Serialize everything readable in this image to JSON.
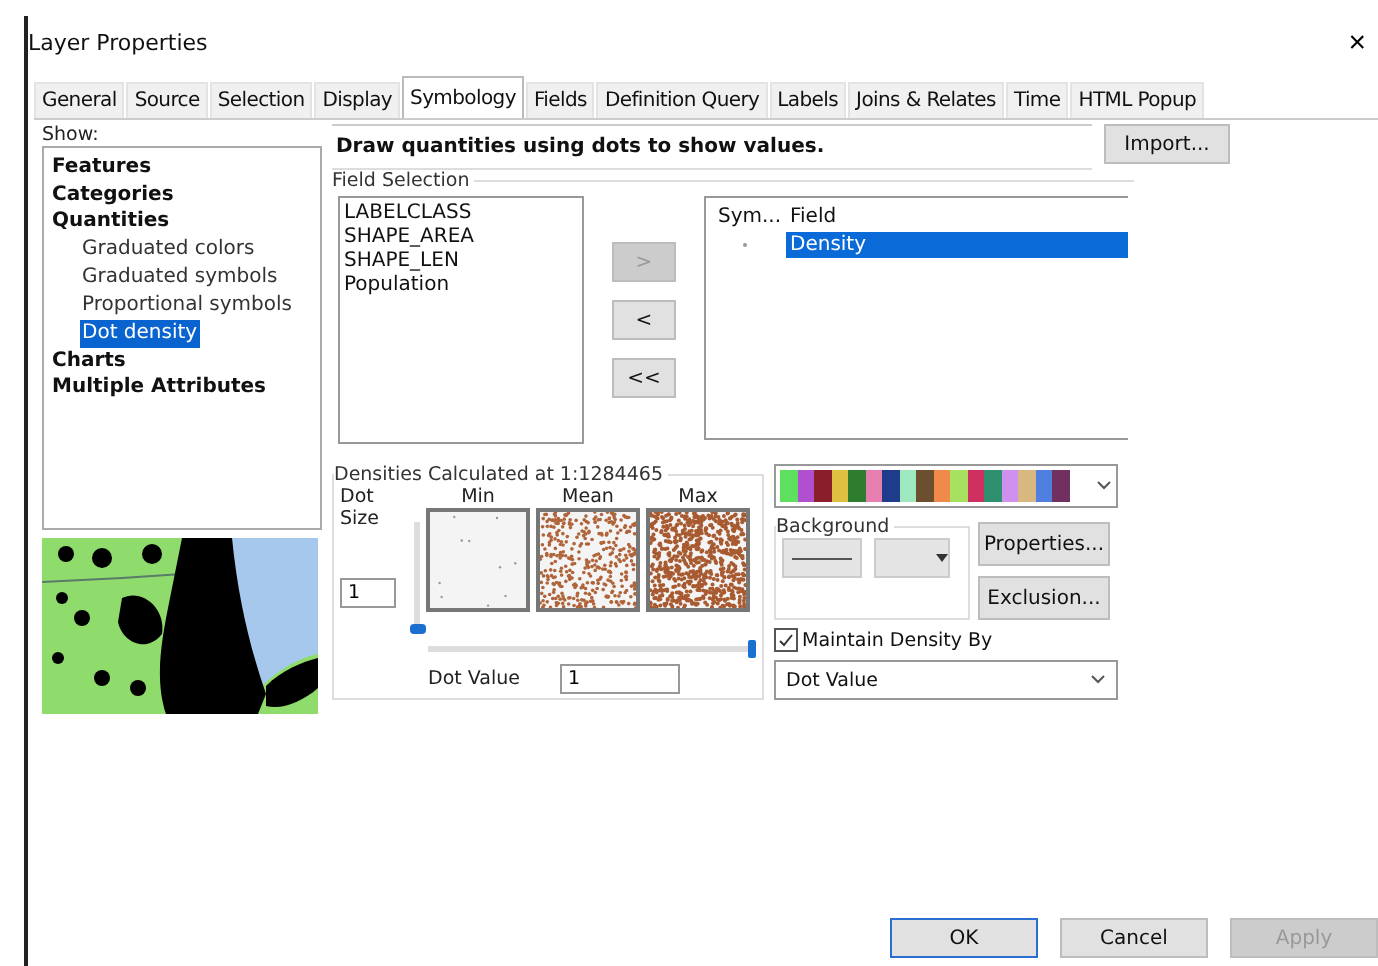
{
  "window": {
    "title": "Layer Properties",
    "close": "×"
  },
  "tabs": [
    {
      "label": "General",
      "selected": false
    },
    {
      "label": "Source",
      "selected": false
    },
    {
      "label": "Selection",
      "selected": false
    },
    {
      "label": "Display",
      "selected": false
    },
    {
      "label": "Symbology",
      "selected": true
    },
    {
      "label": "Fields",
      "selected": false
    },
    {
      "label": "Definition Query",
      "selected": false
    },
    {
      "label": "Labels",
      "selected": false
    },
    {
      "label": "Joins & Relates",
      "selected": false
    },
    {
      "label": "Time",
      "selected": false
    },
    {
      "label": "HTML Popup",
      "selected": false
    }
  ],
  "show_label": "Show:",
  "tree": [
    {
      "label": "Features",
      "selected": false
    },
    {
      "label": "Categories",
      "selected": false
    },
    {
      "label": "Quantities",
      "selected": false,
      "children": [
        {
          "label": "Graduated colors",
          "selected": false
        },
        {
          "label": "Graduated symbols",
          "selected": false
        },
        {
          "label": "Proportional symbols",
          "selected": false
        },
        {
          "label": "Dot density",
          "selected": true
        }
      ]
    },
    {
      "label": "Charts",
      "selected": false
    },
    {
      "label": "Multiple Attributes",
      "selected": false
    }
  ],
  "description": "Draw quantities using dots to show values.",
  "import_button": "Import...",
  "field_selection": {
    "title": "Field Selection",
    "fields": [
      "LABELCLASS",
      "SHAPE_AREA",
      "SHAPE_LEN",
      "Population"
    ],
    "buttons": [
      {
        "label": ">",
        "disabled": true
      },
      {
        "label": "<",
        "disabled": false
      },
      {
        "label": "<<",
        "disabled": false
      }
    ]
  },
  "symbol_table": {
    "columns": [
      "Sym...",
      "Field"
    ],
    "rows": [
      {
        "field": "Density",
        "selected": true
      }
    ]
  },
  "densities": {
    "title": "Densities Calculated at 1:1284465",
    "dot_size_label": "Dot Size",
    "dot_size": "1",
    "dot_size_slider": {
      "level": 0
    },
    "previews": [
      {
        "label": "Min"
      },
      {
        "label": "Mean"
      },
      {
        "label": "Max"
      }
    ],
    "dot_value_label": "Dot Value",
    "dot_value": "1",
    "dot_value_slider": {
      "level": 1
    }
  },
  "color_ramp": [
    {
      "color": "#5ee05e"
    },
    {
      "color": "#b04fd0"
    },
    {
      "color": "#8a1e2a"
    },
    {
      "color": "#e0c040"
    },
    {
      "color": "#2e7d2e"
    },
    {
      "color": "#e77fb0"
    },
    {
      "color": "#1f3c8c"
    },
    {
      "color": "#9ee8c0"
    },
    {
      "color": "#6b4f2f"
    },
    {
      "color": "#f08a4a"
    },
    {
      "color": "#a8e060"
    },
    {
      "color": "#d03060"
    },
    {
      "color": "#2f9070"
    },
    {
      "color": "#d090f0"
    },
    {
      "color": "#d8b880"
    },
    {
      "color": "#4f80e0"
    },
    {
      "color": "#703060"
    }
  ],
  "background": {
    "title": "Background"
  },
  "properties_button": "Properties...",
  "exclusion_button": "Exclusion...",
  "maintain_density": {
    "label": "Maintain Density By",
    "checked": true
  },
  "maintain_select": "Dot Value",
  "buttons": [
    {
      "label": "OK",
      "kind": "default",
      "disabled": false
    },
    {
      "label": "Cancel",
      "kind": "normal",
      "disabled": false
    },
    {
      "label": "Apply",
      "kind": "normal",
      "disabled": true
    }
  ]
}
